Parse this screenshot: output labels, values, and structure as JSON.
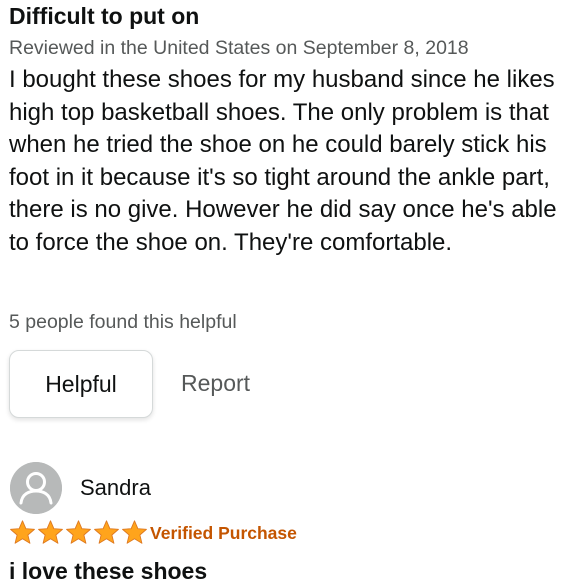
{
  "review": {
    "title": "Difficult to put on",
    "meta": "Reviewed in the United States on September 8, 2018",
    "body": "I bought these shoes for my husband since he likes high top basketball shoes. The only problem is that when he tried the shoe on he could barely stick his foot in it because it's so tight around the ankle part, there is no give. However he did say once he's able to force the shoe on. They're comfortable.",
    "helpful_count": "5 people found this helpful",
    "helpful_label": "Helpful",
    "report_label": "Report"
  },
  "next_review": {
    "reviewer_name": "Sandra",
    "avatar_icon": "default-user-avatar-icon",
    "rating": 5,
    "rating_max": 5,
    "star_icon": "star-icon",
    "verified_label": "Verified Purchase",
    "title": "i love these shoes"
  },
  "colors": {
    "text": "#0f1111",
    "secondary_text": "#565959",
    "star": "#ffa41c",
    "verified": "#c45500",
    "button_border": "#d5d9d9",
    "avatar_bg": "#b7b9b9"
  }
}
